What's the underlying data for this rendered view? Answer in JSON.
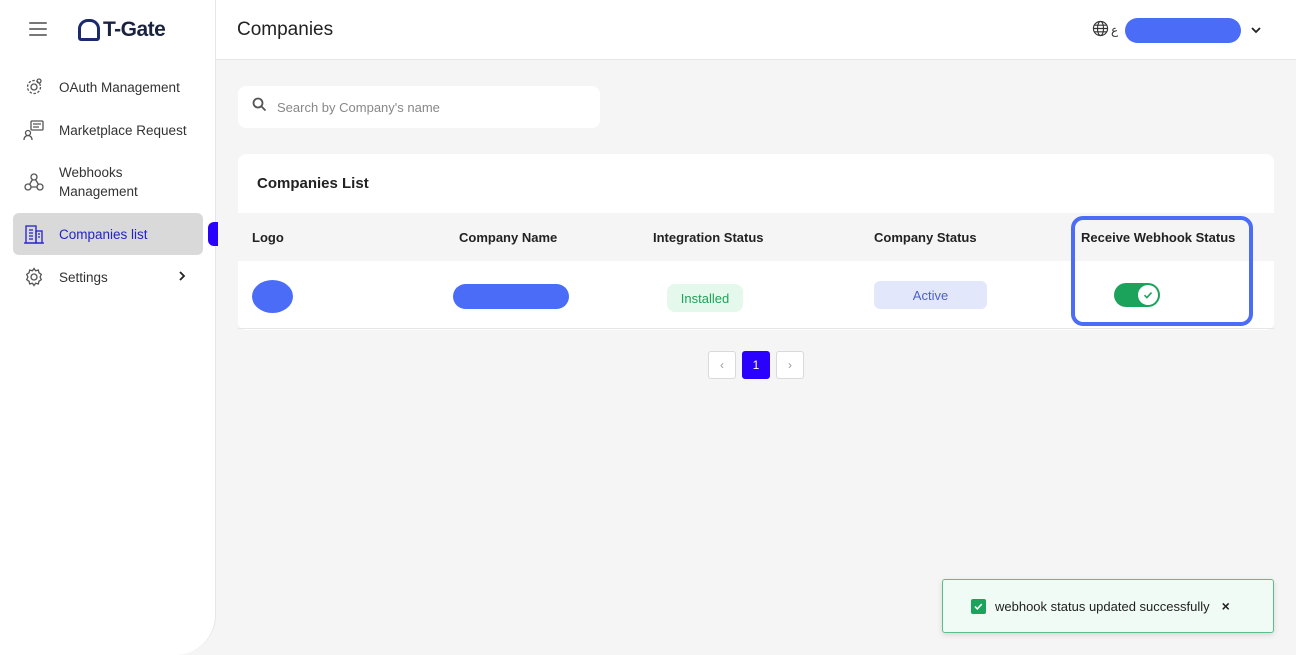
{
  "app": {
    "logo_text": "T-Gate"
  },
  "sidebar": {
    "items": [
      {
        "label": "OAuth Management",
        "icon": "gear-cog-icon"
      },
      {
        "label": "Marketplace Request",
        "icon": "user-chat-icon"
      },
      {
        "label": "Webhooks Management",
        "icon": "webhook-icon"
      },
      {
        "label": "Companies list",
        "icon": "building-icon",
        "active": true
      },
      {
        "label": "Settings",
        "icon": "settings-icon",
        "has_submenu": true
      }
    ]
  },
  "header": {
    "title": "Companies",
    "language_label": "ع"
  },
  "search": {
    "placeholder": "Search by Company's name",
    "value": ""
  },
  "table": {
    "title": "Companies List",
    "columns": [
      "Logo",
      "Company Name",
      "Integration Status",
      "Company Status",
      "Receive Webhook Status"
    ],
    "rows": [
      {
        "integration_status": "Installed",
        "company_status": "Active",
        "webhook_enabled": true
      }
    ]
  },
  "pagination": {
    "prev": "‹",
    "current": "1",
    "next": "›"
  },
  "toast": {
    "message": "webhook status updated successfully",
    "close": "×"
  },
  "colors": {
    "accent": "#2a00ff",
    "redaction": "#4a6cf7",
    "success": "#1ba35c",
    "active_badge_bg": "#e3e7fb",
    "installed_badge_bg": "#e4f8ec"
  }
}
